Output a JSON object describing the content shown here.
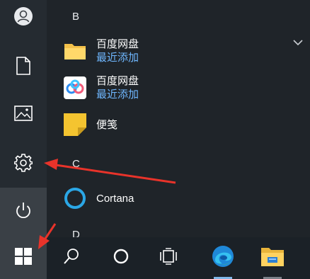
{
  "apps": {
    "section_b": "B",
    "section_c": "C",
    "section_d": "D",
    "items": [
      {
        "name": "百度网盘",
        "sub": "最近添加",
        "icon": "folder-icon"
      },
      {
        "name": "百度网盘",
        "sub": "最近添加",
        "icon": "baidu-netdisk-icon"
      },
      {
        "name": "便笺",
        "icon": "sticky-notes-icon"
      },
      {
        "name": "Cortana",
        "icon": "cortana-icon"
      }
    ]
  },
  "rail": {
    "icons": [
      "user-icon",
      "document-icon",
      "pictures-icon",
      "gear-icon",
      "power-icon"
    ]
  },
  "taskbar": {
    "icons": [
      "windows-logo-icon",
      "search-icon",
      "cortana-circle-icon",
      "task-view-icon",
      "edge-icon",
      "file-explorer-icon"
    ]
  },
  "colors": {
    "accent_blue": "#6fb7ff",
    "annotation_red": "#e8332a",
    "sticky_yellow": "#f4c430"
  }
}
